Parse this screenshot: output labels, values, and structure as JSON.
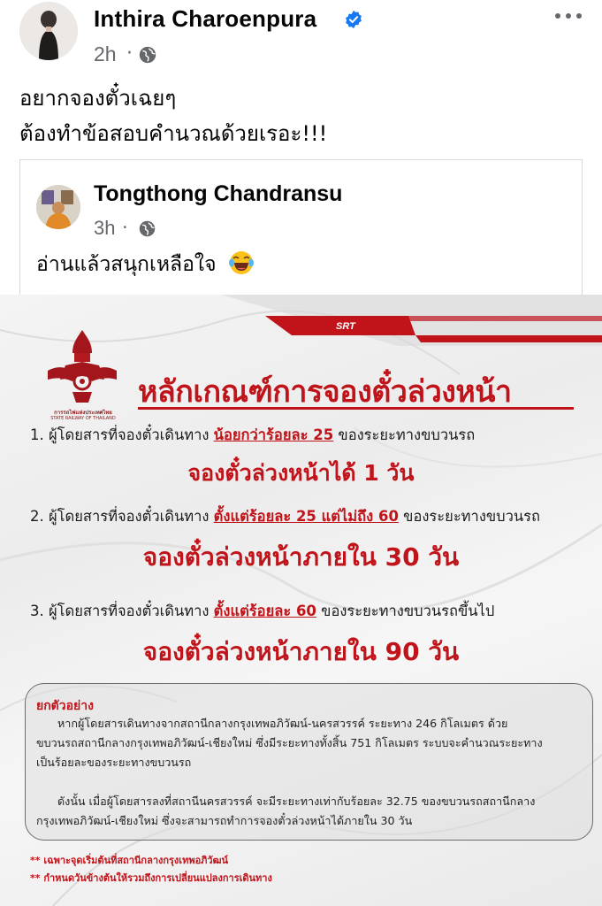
{
  "post": {
    "author": "Inthira Charoenpura",
    "time": "2h",
    "separator": "·",
    "text_line1": "อยากจองตั๋วเฉยๆ",
    "text_line2": "ต้องทำข้อสอบคำนวณด้วยเรอะ!!!"
  },
  "shared_post": {
    "author": "Tongthong Chandransu",
    "time": "3h",
    "separator": "·",
    "text": "อ่านแล้วสนุกเหลือใจ"
  },
  "poster": {
    "brand": "SRT",
    "org_th": "การรถไฟแห่งประเทศไทย",
    "org_en": "STATE RAILWAY OF THAILAND",
    "title": "หลักเกณฑ์การจองตั๋วล่วงหน้า",
    "rules": [
      {
        "prefix": "1.  ผู้โดยสารที่จองตั๋วเดินทาง ",
        "highlight": "น้อยกว่าร้อยละ 25",
        "suffix": " ของระยะทางขบวนรถ",
        "result": "จองตั๋วล่วงหน้าได้ 1 วัน"
      },
      {
        "prefix": "2. ผู้โดยสารที่จองตั๋วเดินทาง ",
        "highlight": "ตั้งแต่ร้อยละ 25 แต่ไม่ถึง 60",
        "suffix": " ของระยะทางขบวนรถ",
        "result": "จองตั๋วล่วงหน้าภายใน 30 วัน"
      },
      {
        "prefix": "3. ผู้โดยสารที่จองตั๋วเดินทาง ",
        "highlight": "ตั้งแต่ร้อยละ 60",
        "suffix": " ของระยะทางขบวนรถขึ้นไป",
        "result": "จองตั๋วล่วงหน้าภายใน 90 วัน"
      }
    ],
    "example": {
      "title": "ยกตัวอย่าง",
      "p1_line1": "หากผู้โดยสารเดินทางจากสถานีกลางกรุงเทพอภิวัฒน์-นครสวรรค์ ระยะทาง 246 กิโลเมตร ด้วย",
      "p1_line2": "ขบวนรถสถานีกลางกรุงเทพอภิวัฒน์-เชียงใหม่ ซึ่งมีระยะทางทั้งสิ้น 751 กิโลเมตร ระบบจะคำนวณระยะทาง",
      "p1_line3": "เป็นร้อยละของระยะทางขบวนรถ",
      "p2_line1": "ดังนั้น เมื่อผู้โดยสารลงที่สถานีนครสวรรค์ จะมีระยะทางเท่ากับร้อยละ 32.75 ของขบวนรถสถานีกลาง",
      "p2_line2": "กรุงเทพอภิวัฒน์-เชียงใหม่ ซึ่งจะสามารถทำการจองตั๋วล่วงหน้าได้ภายใน 30 วัน"
    },
    "footnote1": "** เฉพาะจุดเริ่มต้นที่สถานีกลางกรุงเทพอภิวัฒน์",
    "footnote2": "** กำหนดวันข้างต้นให้รวมถึงการเปลี่ยนแปลงการเดินทาง"
  },
  "colors": {
    "verified": "#1877f2",
    "meta_text": "#65676b",
    "poster_red": "#c0141a"
  },
  "icons": [
    "verified-badge-icon",
    "globe-icon",
    "more-options-icon",
    "laughing-emoji-icon",
    "railway-emblem-icon"
  ]
}
